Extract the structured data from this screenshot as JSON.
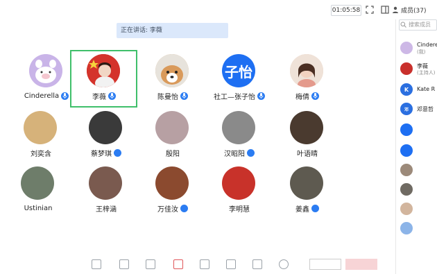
{
  "topbar": {
    "timer": "01:05:58",
    "members_label": "成员(37)"
  },
  "speaking": {
    "text": "正在讲话: 李薇"
  },
  "grid": {
    "row1": [
      {
        "name": "Cinderella",
        "avatar": "pig-cartoon-avatar",
        "color": "#cdb8e6"
      },
      {
        "name": "李薇",
        "avatar": "flag-portrait-avatar",
        "color": "#c9302c"
      },
      {
        "name": "陈曼怡",
        "avatar": "dog-avatar",
        "color": "#d9a46b"
      },
      {
        "name": "社工—张子怡",
        "avatar": "text-avatar",
        "avatar_text": "子怡",
        "color": "#1e6ff2"
      },
      {
        "name": "梅倩",
        "avatar": "girl-avatar",
        "color": "#e9c9b5"
      }
    ],
    "row2": [
      {
        "name": "刘奕含",
        "color": "#d6b27a"
      },
      {
        "name": "蔡梦琪",
        "color": "#3a3a3a"
      },
      {
        "name": "殷阳",
        "color": "#b7a0a3"
      },
      {
        "name": "汉昭阳",
        "color": "#8a8a8a"
      },
      {
        "name": "叶语晴",
        "color": "#4a3a2f"
      }
    ],
    "row3": [
      {
        "name": "Ustinian",
        "color": "#6e7d6a"
      },
      {
        "name": "王梓涵",
        "color": "#7a5a4f"
      },
      {
        "name": "万佳汝",
        "color": "#8b4a2f"
      },
      {
        "name": "李明慧",
        "color": "#c8322a"
      },
      {
        "name": "姜鑫",
        "color": "#5e5a50"
      }
    ]
  },
  "panel": {
    "search_placeholder": "搜索成员",
    "members": [
      {
        "name": "Cinderella",
        "sub": "(我)",
        "color": "#cdb8e6"
      },
      {
        "name": "李薇",
        "sub": "(主持人)",
        "color": "#c9302c"
      },
      {
        "name": "Kate R",
        "sub": "",
        "letter": "K",
        "color": "#1e6ff2"
      },
      {
        "name": "邓意哲",
        "sub": "",
        "letter": "邓",
        "color": "#1e6ff2"
      }
    ]
  },
  "colors": {
    "mic_blue": "#2b7cf2",
    "selection_green": "#3fbf6a",
    "speaking_bg": "#dbe8fb"
  }
}
